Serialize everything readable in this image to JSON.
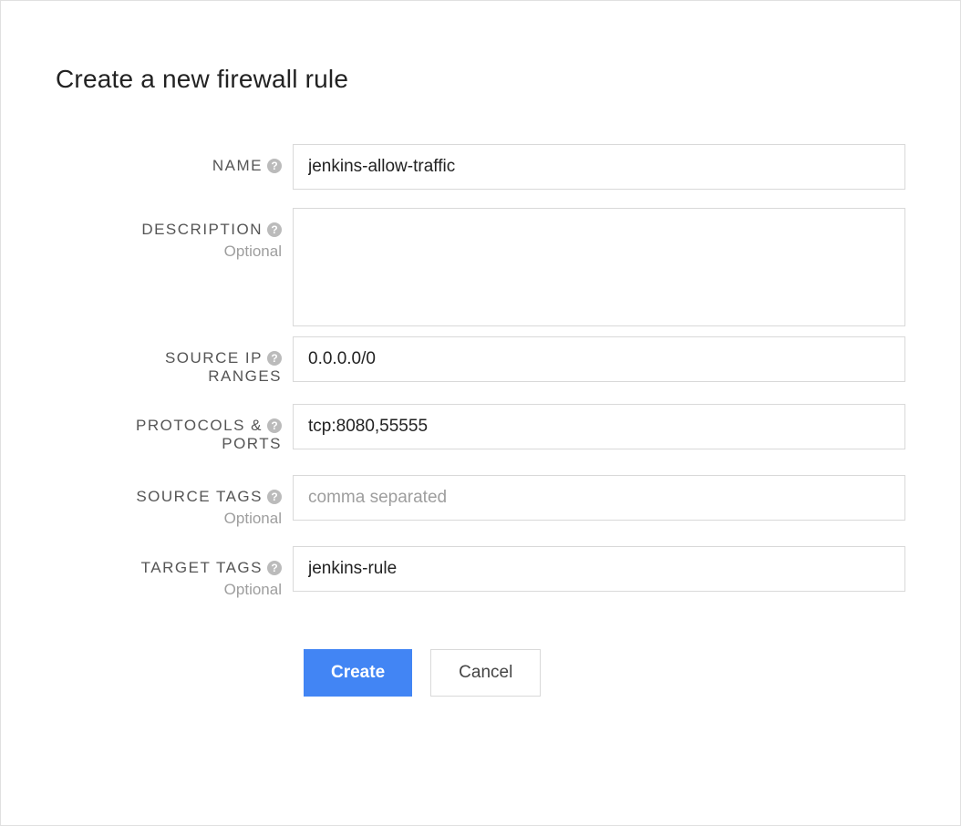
{
  "title": "Create a new firewall rule",
  "fields": {
    "name": {
      "label": "NAME",
      "value": "jenkins-allow-traffic"
    },
    "description": {
      "label": "DESCRIPTION",
      "optional": "Optional",
      "value": ""
    },
    "sourceIp": {
      "label_line1": "SOURCE IP",
      "label_line2": "RANGES",
      "value": "0.0.0.0/0"
    },
    "protocols": {
      "label_line1": "PROTOCOLS &",
      "label_line2": "PORTS",
      "value": "tcp:8080,55555"
    },
    "sourceTags": {
      "label": "SOURCE TAGS",
      "optional": "Optional",
      "placeholder": "comma separated",
      "value": ""
    },
    "targetTags": {
      "label": "TARGET TAGS",
      "optional": "Optional",
      "value": "jenkins-rule"
    }
  },
  "buttons": {
    "create": "Create",
    "cancel": "Cancel"
  }
}
